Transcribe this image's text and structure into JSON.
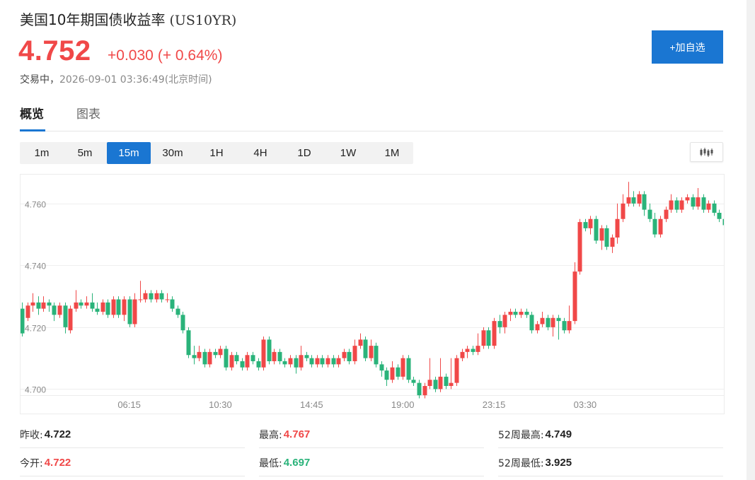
{
  "header": {
    "title": "美国10年期国债收益率",
    "symbol": "(US10YR)",
    "price": "4.752",
    "change": "+0.030",
    "change_pct": "(+ 0.64%)",
    "status": "交易中，",
    "timestamp": "2026-09-01 03:36:49",
    "timezone": "(北京时间)",
    "add_button_label": "+加自选"
  },
  "tabs": [
    {
      "label": "概览",
      "active": true
    },
    {
      "label": "图表",
      "active": false
    }
  ],
  "periods": [
    {
      "label": "1m",
      "active": false
    },
    {
      "label": "5m",
      "active": false
    },
    {
      "label": "15m",
      "active": true
    },
    {
      "label": "30m",
      "active": false
    },
    {
      "label": "1H",
      "active": false
    },
    {
      "label": "4H",
      "active": false
    },
    {
      "label": "1D",
      "active": false
    },
    {
      "label": "1W",
      "active": false
    },
    {
      "label": "1M",
      "active": false
    }
  ],
  "chart_type_icon": "candlestick-icon",
  "colors": {
    "up": "#f04848",
    "down": "#2ab37a",
    "accent": "#1a76d2"
  },
  "chart_data": {
    "type": "candlestick",
    "ylim": [
      4.696,
      4.768
    ],
    "y_ticks": [
      "4.760",
      "4.740",
      "4.720",
      "4.700"
    ],
    "x_ticks": [
      "06:15",
      "10:30",
      "14:45",
      "19:00",
      "23:15",
      "03:30"
    ],
    "x_tick_index": [
      20,
      37,
      54,
      71,
      88,
      105
    ],
    "up_color": "#f04848",
    "down_color": "#2ab37a",
    "candles": [
      [
        4.726,
        4.718,
        4.728,
        4.717
      ],
      [
        4.723,
        4.727,
        4.728,
        4.722
      ],
      [
        4.727,
        4.728,
        4.731,
        4.725
      ],
      [
        4.728,
        4.726,
        4.73,
        4.724
      ],
      [
        4.726,
        4.728,
        4.73,
        4.725
      ],
      [
        4.728,
        4.727,
        4.729,
        4.725
      ],
      [
        4.727,
        4.724,
        4.728,
        4.722
      ],
      [
        4.724,
        4.727,
        4.728,
        4.723
      ],
      [
        4.727,
        4.72,
        4.728,
        4.718
      ],
      [
        4.719,
        4.726,
        4.727,
        4.718
      ],
      [
        4.726,
        4.728,
        4.732,
        4.725
      ],
      [
        4.728,
        4.727,
        4.729,
        4.726
      ],
      [
        4.727,
        4.728,
        4.73,
        4.726
      ],
      [
        4.728,
        4.726,
        4.731,
        4.725
      ],
      [
        4.726,
        4.725,
        4.728,
        4.724
      ],
      [
        4.725,
        4.728,
        4.729,
        4.724
      ],
      [
        4.728,
        4.724,
        4.729,
        4.723
      ],
      [
        4.724,
        4.729,
        4.73,
        4.723
      ],
      [
        4.729,
        4.724,
        4.73,
        4.723
      ],
      [
        4.724,
        4.729,
        4.73,
        4.722
      ],
      [
        4.729,
        4.721,
        4.73,
        4.72
      ],
      [
        4.721,
        4.729,
        4.731,
        4.72
      ],
      [
        4.729,
        4.729,
        4.735,
        4.728
      ],
      [
        4.729,
        4.731,
        4.732,
        4.728
      ],
      [
        4.731,
        4.729,
        4.732,
        4.728
      ],
      [
        4.729,
        4.731,
        4.732,
        4.728
      ],
      [
        4.731,
        4.729,
        4.732,
        4.728
      ],
      [
        4.729,
        4.729,
        4.731,
        4.728
      ],
      [
        4.729,
        4.726,
        4.73,
        4.725
      ],
      [
        4.726,
        4.724,
        4.727,
        4.723
      ],
      [
        4.724,
        4.719,
        4.725,
        4.718
      ],
      [
        4.719,
        4.711,
        4.72,
        4.71
      ],
      [
        4.711,
        4.71,
        4.714,
        4.708
      ],
      [
        4.71,
        4.712,
        4.714,
        4.709
      ],
      [
        4.712,
        4.708,
        4.713,
        4.707
      ],
      [
        4.708,
        4.712,
        4.713,
        4.707
      ],
      [
        4.712,
        4.711,
        4.713,
        4.71
      ],
      [
        4.711,
        4.713,
        4.714,
        4.71
      ],
      [
        4.713,
        4.707,
        4.714,
        4.706
      ],
      [
        4.707,
        4.711,
        4.712,
        4.706
      ],
      [
        4.711,
        4.709,
        4.712,
        4.708
      ],
      [
        4.709,
        4.707,
        4.71,
        4.706
      ],
      [
        4.707,
        4.711,
        4.712,
        4.706
      ],
      [
        4.711,
        4.709,
        4.712,
        4.708
      ],
      [
        4.709,
        4.707,
        4.71,
        4.706
      ],
      [
        4.707,
        4.716,
        4.717,
        4.706
      ],
      [
        4.716,
        4.709,
        4.717,
        4.708
      ],
      [
        4.709,
        4.712,
        4.713,
        4.708
      ],
      [
        4.712,
        4.709,
        4.713,
        4.708
      ],
      [
        4.709,
        4.708,
        4.71,
        4.707
      ],
      [
        4.708,
        4.71,
        4.711,
        4.707
      ],
      [
        4.71,
        4.707,
        4.711,
        4.705
      ],
      [
        4.707,
        4.711,
        4.714,
        4.706
      ],
      [
        4.711,
        4.71,
        4.712,
        4.709
      ],
      [
        4.71,
        4.708,
        4.711,
        4.707
      ],
      [
        4.708,
        4.71,
        4.711,
        4.707
      ],
      [
        4.71,
        4.708,
        4.711,
        4.707
      ],
      [
        4.708,
        4.71,
        4.711,
        4.707
      ],
      [
        4.71,
        4.708,
        4.711,
        4.707
      ],
      [
        4.708,
        4.71,
        4.711,
        4.707
      ],
      [
        4.71,
        4.712,
        4.713,
        4.709
      ],
      [
        4.712,
        4.709,
        4.713,
        4.708
      ],
      [
        4.709,
        4.714,
        4.716,
        4.708
      ],
      [
        4.714,
        4.716,
        4.718,
        4.713
      ],
      [
        4.716,
        4.71,
        4.717,
        4.709
      ],
      [
        4.71,
        4.714,
        4.716,
        4.709
      ],
      [
        4.714,
        4.708,
        4.715,
        4.707
      ],
      [
        4.708,
        4.706,
        4.709,
        4.704
      ],
      [
        4.706,
        4.703,
        4.707,
        4.701
      ],
      [
        4.703,
        4.707,
        4.709,
        4.702
      ],
      [
        4.707,
        4.704,
        4.708,
        4.703
      ],
      [
        4.704,
        4.71,
        4.711,
        4.703
      ],
      [
        4.71,
        4.703,
        4.711,
        4.702
      ],
      [
        4.703,
        4.702,
        4.704,
        4.701
      ],
      [
        4.702,
        4.698,
        4.703,
        4.697
      ],
      [
        4.698,
        4.701,
        4.702,
        4.697
      ],
      [
        4.701,
        4.703,
        4.71,
        4.7
      ],
      [
        4.703,
        4.7,
        4.704,
        4.699
      ],
      [
        4.7,
        4.704,
        4.71,
        4.699
      ],
      [
        4.704,
        4.701,
        4.705,
        4.7
      ],
      [
        4.701,
        4.702,
        4.71,
        4.7
      ],
      [
        4.702,
        4.71,
        4.711,
        4.701
      ],
      [
        4.71,
        4.712,
        4.713,
        4.709
      ],
      [
        4.712,
        4.713,
        4.714,
        4.71
      ],
      [
        4.713,
        4.712,
        4.714,
        4.711
      ],
      [
        4.712,
        4.714,
        4.718,
        4.711
      ],
      [
        4.714,
        4.719,
        4.72,
        4.713
      ],
      [
        4.719,
        4.714,
        4.72,
        4.713
      ],
      [
        4.714,
        4.722,
        4.723,
        4.713
      ],
      [
        4.722,
        4.72,
        4.724,
        4.718
      ],
      [
        4.72,
        4.724,
        4.725,
        4.718
      ],
      [
        4.724,
        4.725,
        4.726,
        4.722
      ],
      [
        4.725,
        4.724,
        4.726,
        4.723
      ],
      [
        4.724,
        4.725,
        4.726,
        4.723
      ],
      [
        4.725,
        4.724,
        4.726,
        4.723
      ],
      [
        4.724,
        4.719,
        4.725,
        4.718
      ],
      [
        4.719,
        4.721,
        4.722,
        4.718
      ],
      [
        4.721,
        4.723,
        4.725,
        4.72
      ],
      [
        4.723,
        4.72,
        4.724,
        4.719
      ],
      [
        4.72,
        4.723,
        4.724,
        4.717
      ],
      [
        4.723,
        4.722,
        4.724,
        4.716
      ],
      [
        4.722,
        4.719,
        4.723,
        4.718
      ],
      [
        4.719,
        4.722,
        4.727,
        4.718
      ],
      [
        4.722,
        4.738,
        4.741,
        4.721
      ],
      [
        4.738,
        4.754,
        4.755,
        4.737
      ],
      [
        4.754,
        4.752,
        4.755,
        4.751
      ],
      [
        4.752,
        4.755,
        4.756,
        4.75
      ],
      [
        4.755,
        4.748,
        4.756,
        4.747
      ],
      [
        4.748,
        4.752,
        4.753,
        4.745
      ],
      [
        4.752,
        4.746,
        4.753,
        4.745
      ],
      [
        4.746,
        4.749,
        4.75,
        4.744
      ],
      [
        4.749,
        4.755,
        4.76,
        4.747
      ],
      [
        4.755,
        4.76,
        4.763,
        4.754
      ],
      [
        4.76,
        4.762,
        4.767,
        4.759
      ],
      [
        4.762,
        4.76,
        4.764,
        4.759
      ],
      [
        4.76,
        4.763,
        4.764,
        4.759
      ],
      [
        4.763,
        4.758,
        4.764,
        4.756
      ],
      [
        4.758,
        4.755,
        4.76,
        4.754
      ],
      [
        4.755,
        4.75,
        4.757,
        4.749
      ],
      [
        4.75,
        4.755,
        4.756,
        4.749
      ],
      [
        4.755,
        4.758,
        4.759,
        4.754
      ],
      [
        4.758,
        4.761,
        4.763,
        4.757
      ],
      [
        4.761,
        4.758,
        4.762,
        4.757
      ],
      [
        4.758,
        4.761,
        4.762,
        4.757
      ],
      [
        4.761,
        4.762,
        4.763,
        4.76
      ],
      [
        4.762,
        4.759,
        4.763,
        4.758
      ],
      [
        4.759,
        4.762,
        4.765,
        4.758
      ],
      [
        4.762,
        4.758,
        4.763,
        4.757
      ],
      [
        4.758,
        4.76,
        4.761,
        4.757
      ],
      [
        4.76,
        4.757,
        4.761,
        4.756
      ],
      [
        4.757,
        4.755,
        4.758,
        4.754
      ],
      [
        4.755,
        4.753,
        4.756,
        4.752
      ],
      [
        4.753,
        4.756,
        4.757,
        4.752
      ],
      [
        4.756,
        4.754,
        4.757,
        4.753
      ],
      [
        4.754,
        4.756,
        4.757,
        4.753
      ],
      [
        4.756,
        4.757,
        4.758,
        4.755
      ],
      [
        4.757,
        4.756,
        4.758,
        4.755
      ],
      [
        4.756,
        4.758,
        4.759,
        4.755
      ],
      [
        4.758,
        4.755,
        4.759,
        4.754
      ],
      [
        4.755,
        4.759,
        4.76,
        4.754
      ],
      [
        4.759,
        4.757,
        4.76,
        4.756
      ],
      [
        4.757,
        4.76,
        4.763,
        4.756
      ],
      [
        4.76,
        4.757,
        4.761,
        4.756
      ],
      [
        4.757,
        4.755,
        4.758,
        4.754
      ],
      [
        4.755,
        4.752,
        4.756,
        4.751
      ],
      [
        4.752,
        4.75,
        4.753,
        4.749
      ],
      [
        4.75,
        4.752,
        4.753,
        4.747
      ]
    ]
  },
  "stats": [
    {
      "label": "昨收:",
      "value": "4.722",
      "tone": "neutral"
    },
    {
      "label": "最高:",
      "value": "4.767",
      "tone": "up"
    },
    {
      "label": "52周最高:",
      "value": "4.749",
      "tone": "neutral"
    },
    {
      "label": "今开:",
      "value": "4.722",
      "tone": "up"
    },
    {
      "label": "最低:",
      "value": "4.697",
      "tone": "down"
    },
    {
      "label": "52周最低:",
      "value": "3.925",
      "tone": "neutral"
    }
  ]
}
